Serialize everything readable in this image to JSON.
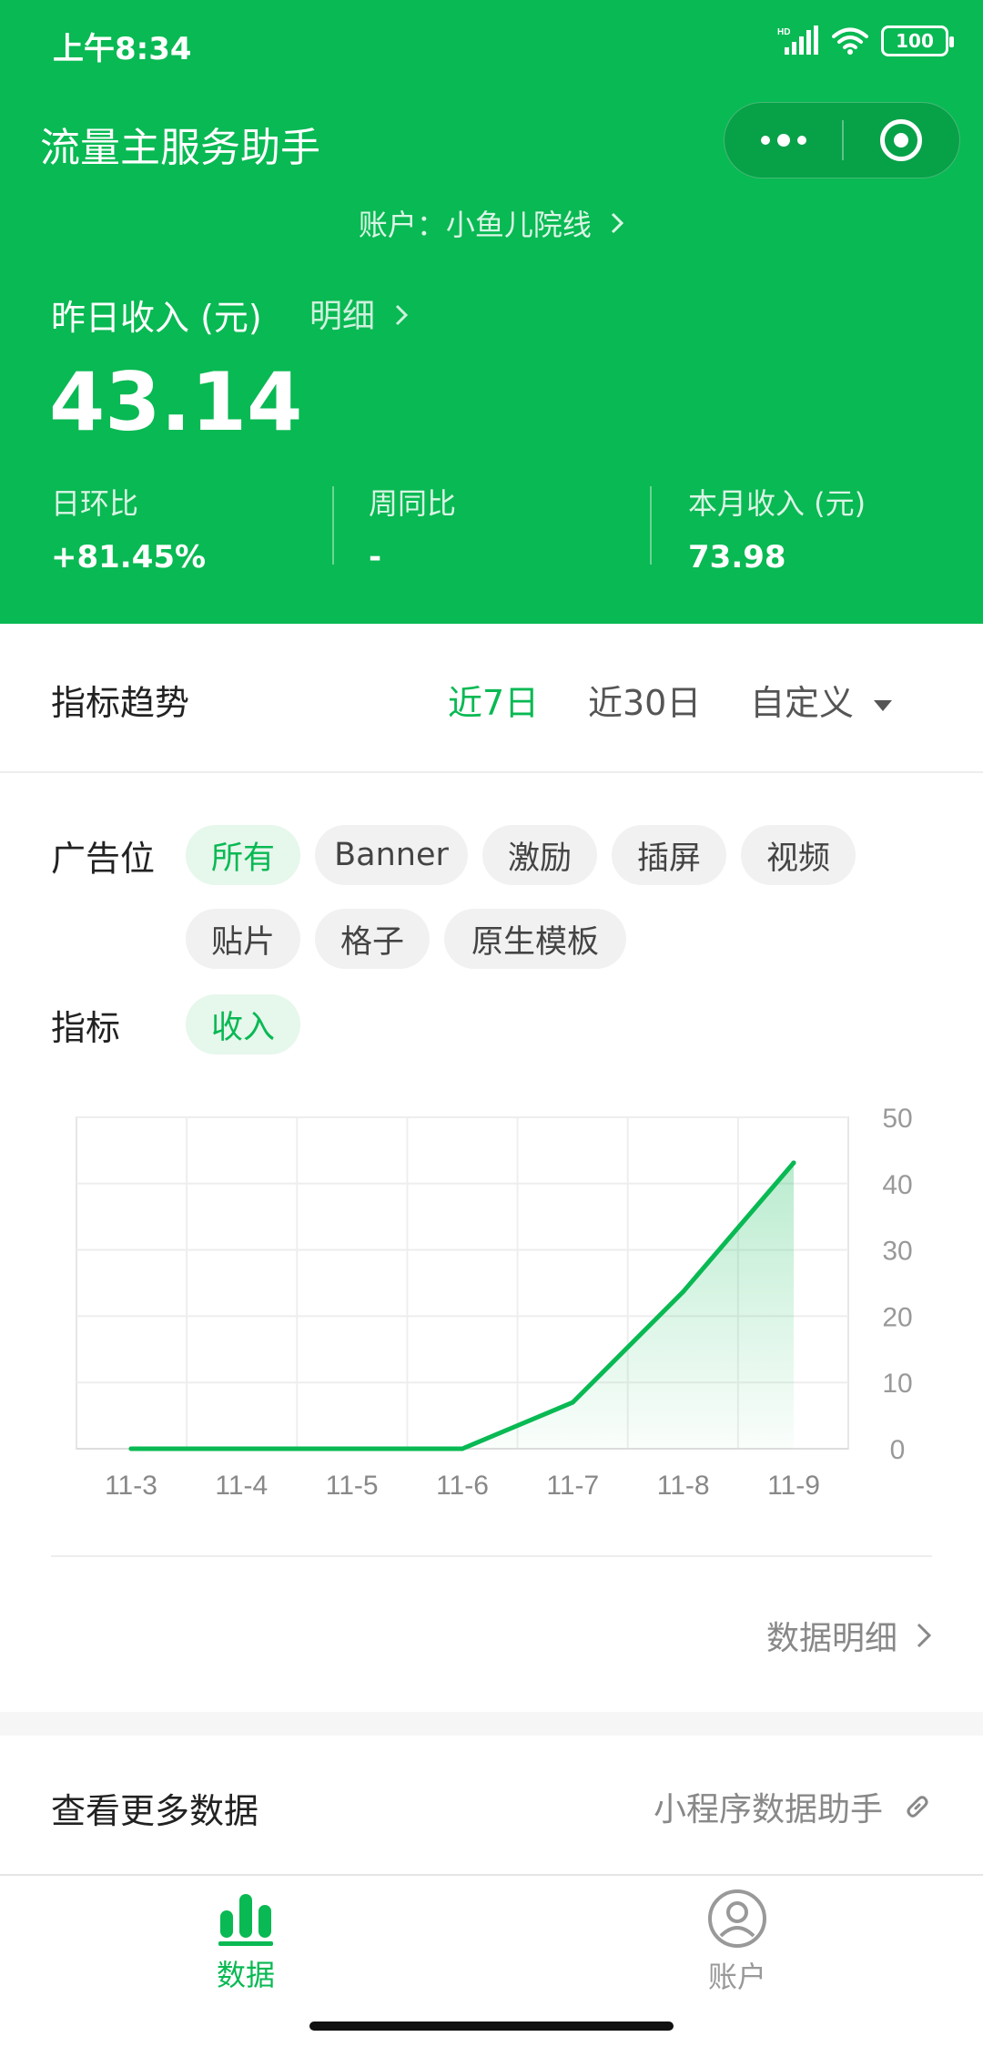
{
  "status_bar": {
    "time": "上午8:34",
    "battery": "100"
  },
  "nav": {
    "title": "流量主服务助手"
  },
  "account": {
    "label": "账户：小鱼儿院线"
  },
  "income": {
    "yesterday_label": "昨日收入 (元)",
    "detail_label": "明细",
    "value": "43.14",
    "stats": [
      {
        "label": "日环比",
        "value": "+81.45%"
      },
      {
        "label": "周同比",
        "value": "-"
      },
      {
        "label": "本月收入 (元)",
        "value": "73.98"
      }
    ]
  },
  "trend": {
    "title": "指标趋势",
    "ranges": [
      "近7日",
      "近30日",
      "自定义"
    ],
    "active_range": "近7日"
  },
  "filters": {
    "ad_slot_label": "广告位",
    "ad_slots": [
      "所有",
      "Banner",
      "激励",
      "插屏",
      "视频",
      "贴片",
      "格子",
      "原生模板"
    ],
    "active_ad_slot": "所有",
    "metric_label": "指标",
    "metrics": [
      "收入"
    ],
    "active_metric": "收入"
  },
  "chart_data": {
    "type": "area",
    "categories": [
      "11-3",
      "11-4",
      "11-5",
      "11-6",
      "11-7",
      "11-8",
      "11-9"
    ],
    "series": [
      {
        "values": [
          0,
          0,
          0,
          0,
          7,
          23.7,
          43.14
        ]
      }
    ],
    "y_ticks": [
      "0",
      "10",
      "20",
      "30",
      "40",
      "50"
    ],
    "ylim": [
      0,
      50
    ],
    "y_axis_side": "right",
    "grid": true,
    "color": "#09b953"
  },
  "data_detail": {
    "label": "数据明细"
  },
  "more": {
    "title": "查看更多数据",
    "link_label": "小程序数据助手"
  },
  "tabbar": {
    "items": [
      "数据",
      "账户"
    ],
    "active": "数据"
  },
  "colors": {
    "primary": "#09b953",
    "chip_bg": "#f1f1f1",
    "chip_active_bg": "#e6f7ec"
  }
}
